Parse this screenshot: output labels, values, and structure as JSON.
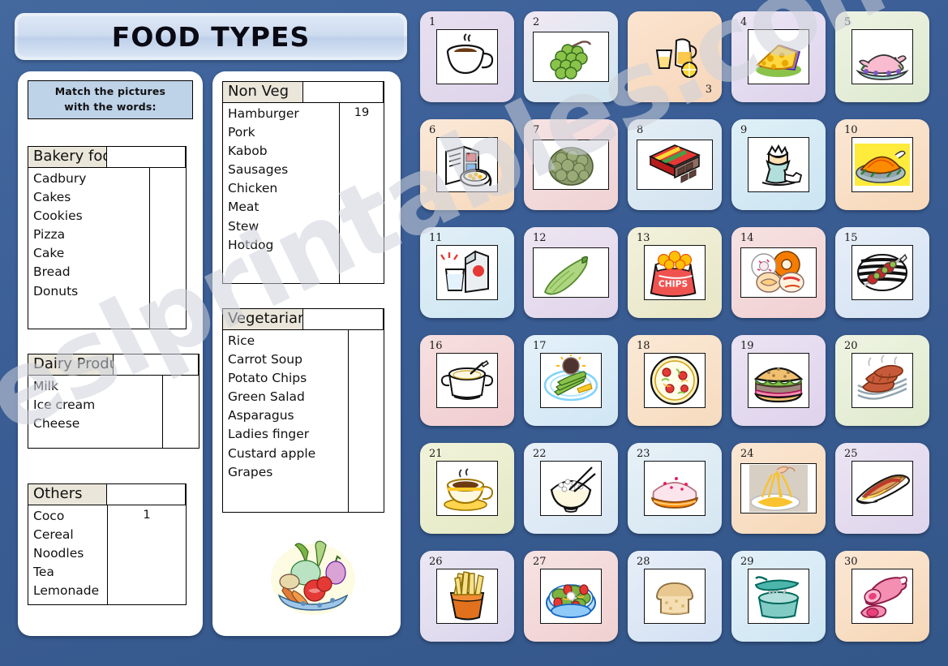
{
  "title": "FOOD TYPES",
  "instruction": {
    "line1": "Match the pictures",
    "line2": "with the words:"
  },
  "tables": [
    {
      "id": "bakery",
      "header": "Bakery foods",
      "words": [
        "Cadbury",
        "Cakes",
        "Cookies",
        "Pizza",
        "Cake",
        "Bread",
        "Donuts"
      ],
      "answers": [
        "",
        "",
        "",
        "",
        "",
        "",
        ""
      ]
    },
    {
      "id": "dairy",
      "header": "Dairy Products",
      "words": [
        "Milk",
        "Ice cream",
        "Cheese"
      ],
      "answers": [
        "",
        "",
        ""
      ]
    },
    {
      "id": "others",
      "header": "Others",
      "words": [
        "Coco",
        "Cereal",
        "Noodles",
        "Tea",
        "Lemonade"
      ],
      "answers": [
        "1",
        "",
        "",
        "",
        ""
      ]
    },
    {
      "id": "nonveg",
      "header": "Non Veg",
      "words": [
        "Hamburger",
        "Pork",
        "Kabob",
        "Sausages",
        "Chicken",
        "Meat",
        "Stew",
        "Hotdog"
      ],
      "answers": [
        "19",
        "",
        "",
        "",
        "",
        "",
        "",
        ""
      ]
    },
    {
      "id": "vegetarian",
      "header": "Vegetarian",
      "words": [
        "Rice",
        "Carrot Soup",
        "Potato Chips",
        "Green Salad",
        "Asparagus",
        "Ladies finger",
        "Custard apple",
        "Grapes"
      ],
      "answers": [
        "",
        "",
        "",
        "",
        "",
        "",
        "",
        ""
      ]
    }
  ],
  "watermark": "eslprintables.com",
  "pictures": [
    {
      "number": "1",
      "icon": "coffee-cup-icon",
      "tile_color_a": "#e8dff0",
      "tile_color_b": "#ddd4ea",
      "number_pos": "top-left"
    },
    {
      "number": "2",
      "icon": "grapes-icon",
      "tile_color_a": "#f2e9f3",
      "tile_color_b": "#cfe6f0",
      "number_pos": "top-left"
    },
    {
      "number": "3",
      "icon": "lemonade-jug-icon",
      "tile_color_a": "#fbe4cf",
      "tile_color_b": "#f6d6bb",
      "number_pos": "bottom-right"
    },
    {
      "number": "4",
      "icon": "cheese-wedge-icon",
      "tile_color_a": "#ece6f4",
      "tile_color_b": "#ddd3ec",
      "number_pos": "top-left"
    },
    {
      "number": "5",
      "icon": "roast-pork-icon",
      "tile_color_a": "#eef3e3",
      "tile_color_b": "#dde9cf",
      "number_pos": "top-left"
    },
    {
      "number": "6",
      "icon": "cereal-box-icon",
      "tile_color_a": "#fbe9d8",
      "tile_color_b": "#f6d9bd",
      "number_pos": "top-left"
    },
    {
      "number": "7",
      "icon": "custard-apple-icon",
      "tile_color_a": "#f6e3e3",
      "tile_color_b": "#efd2d4",
      "number_pos": "top-left"
    },
    {
      "number": "8",
      "icon": "chocolate-bar-icon",
      "tile_color_a": "#e4eef5",
      "tile_color_b": "#d2e3f0",
      "number_pos": "bottom-left"
    },
    {
      "number": "9",
      "icon": "boiled-egg-icon",
      "tile_color_a": "#dff0f7",
      "tile_color_b": "#cbe5f2",
      "number_pos": "top-left"
    },
    {
      "number": "10",
      "icon": "roast-chicken-icon",
      "tile_color_a": "#fbe7d5",
      "tile_color_b": "#f7d8b9",
      "number_pos": "top-left"
    },
    {
      "number": "11",
      "icon": "milk-carton-icon",
      "tile_color_a": "#e2eff7",
      "tile_color_b": "#cee6f2",
      "number_pos": "top-left"
    },
    {
      "number": "12",
      "icon": "okra-icon",
      "tile_color_a": "#eee6f2",
      "tile_color_b": "#e0d4ea",
      "number_pos": "top-left"
    },
    {
      "number": "13",
      "icon": "chips-bag-icon",
      "tile_color_a": "#f2f1dc",
      "tile_color_b": "#e8e6c6",
      "number_pos": "top-left"
    },
    {
      "number": "14",
      "icon": "donuts-icon",
      "tile_color_a": "#f7e2e2",
      "tile_color_b": "#f0cfd2",
      "number_pos": "top-left"
    },
    {
      "number": "15",
      "icon": "kabob-grill-icon",
      "tile_color_a": "#e6eef8",
      "tile_color_b": "#d4e2f3",
      "number_pos": "top-left"
    },
    {
      "number": "16",
      "icon": "soup-pot-icon",
      "tile_color_a": "#f7e0e0",
      "tile_color_b": "#f0cccf",
      "number_pos": "top-left"
    },
    {
      "number": "17",
      "icon": "asparagus-icon",
      "tile_color_a": "#e4f1f9",
      "tile_color_b": "#d0e6f4",
      "number_pos": "top-left"
    },
    {
      "number": "18",
      "icon": "pizza-icon",
      "tile_color_a": "#fbe9d6",
      "tile_color_b": "#f6dbbe",
      "number_pos": "top-left"
    },
    {
      "number": "19",
      "icon": "hamburger-icon",
      "tile_color_a": "#ece4f3",
      "tile_color_b": "#ded2ec",
      "number_pos": "top-left"
    },
    {
      "number": "20",
      "icon": "sausages-icon",
      "tile_color_a": "#eef4e2",
      "tile_color_b": "#dfeacd",
      "number_pos": "top-left"
    },
    {
      "number": "21",
      "icon": "tea-cup-icon",
      "tile_color_a": "#f1f3da",
      "tile_color_b": "#e5e9c4",
      "number_pos": "top-left"
    },
    {
      "number": "22",
      "icon": "rice-bowl-icon",
      "tile_color_a": "#e9f1f8",
      "tile_color_b": "#d8e6f3",
      "number_pos": "top-left"
    },
    {
      "number": "23",
      "icon": "frosted-cake-icon",
      "tile_color_a": "#e7f1f7",
      "tile_color_b": "#d5e6f1",
      "number_pos": "top-left"
    },
    {
      "number": "24",
      "icon": "noodles-icon",
      "tile_color_a": "#fbe7d4",
      "tile_color_b": "#f6d8b8",
      "number_pos": "top-left"
    },
    {
      "number": "25",
      "icon": "hotdog-icon",
      "tile_color_a": "#ece5f3",
      "tile_color_b": "#ded4ec",
      "number_pos": "top-left"
    },
    {
      "number": "26",
      "icon": "french-fries-icon",
      "tile_color_a": "#ebe7f3",
      "tile_color_b": "#dbd5ec",
      "number_pos": "top-left"
    },
    {
      "number": "27",
      "icon": "green-salad-icon",
      "tile_color_a": "#f7e3e2",
      "tile_color_b": "#f0d0d1",
      "number_pos": "top-left"
    },
    {
      "number": "28",
      "icon": "bread-slice-icon",
      "tile_color_a": "#e6eef8",
      "tile_color_b": "#d4e1f3",
      "number_pos": "top-left"
    },
    {
      "number": "29",
      "icon": "cooking-pot-icon",
      "tile_color_a": "#e2f0f8",
      "tile_color_b": "#cee6f3",
      "number_pos": "top-left"
    },
    {
      "number": "30",
      "icon": "ham-meat-icon",
      "tile_color_a": "#fbe7d4",
      "tile_color_b": "#f6d7b7",
      "number_pos": "top-left"
    }
  ]
}
